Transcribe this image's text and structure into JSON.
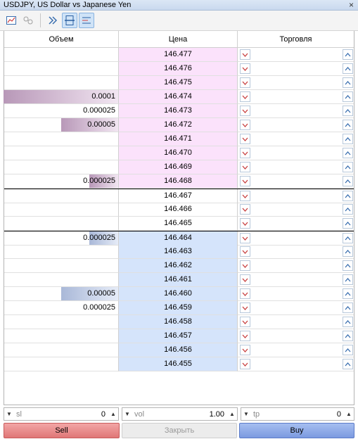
{
  "window": {
    "title": "USDJPY, US Dollar vs Japanese Yen",
    "close_glyph": "×"
  },
  "toolbar": {
    "icons": [
      "chart-icon",
      "linked-chart-icon",
      "auto-scroll-icon",
      "center-price-icon",
      "tick-chart-icon"
    ]
  },
  "table": {
    "headers": {
      "volume": "Объем",
      "price": "Цена",
      "trading": "Торговля"
    },
    "rows": [
      {
        "price": "146.477",
        "volume": "",
        "side": "ask",
        "bar_fraction": 0
      },
      {
        "price": "146.476",
        "volume": "",
        "side": "ask",
        "bar_fraction": 0
      },
      {
        "price": "146.475",
        "volume": "",
        "side": "ask",
        "bar_fraction": 0
      },
      {
        "price": "146.474",
        "volume": "0.0001",
        "side": "ask",
        "bar_fraction": 1.0
      },
      {
        "price": "146.473",
        "volume": "0.000025",
        "side": "ask",
        "bar_fraction": 0
      },
      {
        "price": "146.472",
        "volume": "0.00005",
        "side": "ask",
        "bar_fraction": 0.5
      },
      {
        "price": "146.471",
        "volume": "",
        "side": "ask",
        "bar_fraction": 0
      },
      {
        "price": "146.470",
        "volume": "",
        "side": "ask",
        "bar_fraction": 0
      },
      {
        "price": "146.469",
        "volume": "",
        "side": "ask",
        "bar_fraction": 0
      },
      {
        "price": "146.468",
        "volume": "0.000025",
        "side": "ask",
        "bar_fraction": 0.25
      },
      {
        "price": "146.467",
        "volume": "",
        "side": "spread",
        "bar_fraction": 0
      },
      {
        "price": "146.466",
        "volume": "",
        "side": "spread",
        "bar_fraction": 0
      },
      {
        "price": "146.465",
        "volume": "",
        "side": "spread",
        "bar_fraction": 0
      },
      {
        "price": "146.464",
        "volume": "0.000025",
        "side": "bid",
        "bar_fraction": 0.25
      },
      {
        "price": "146.463",
        "volume": "",
        "side": "bid",
        "bar_fraction": 0
      },
      {
        "price": "146.462",
        "volume": "",
        "side": "bid",
        "bar_fraction": 0
      },
      {
        "price": "146.461",
        "volume": "",
        "side": "bid",
        "bar_fraction": 0
      },
      {
        "price": "146.460",
        "volume": "0.00005",
        "side": "bid",
        "bar_fraction": 0.5
      },
      {
        "price": "146.459",
        "volume": "0.000025",
        "side": "bid",
        "bar_fraction": 0
      },
      {
        "price": "146.458",
        "volume": "",
        "side": "bid",
        "bar_fraction": 0
      },
      {
        "price": "146.457",
        "volume": "",
        "side": "bid",
        "bar_fraction": 0
      },
      {
        "price": "146.456",
        "volume": "",
        "side": "bid",
        "bar_fraction": 0
      },
      {
        "price": "146.455",
        "volume": "",
        "side": "bid",
        "bar_fraction": 0
      }
    ]
  },
  "fields": {
    "sl": {
      "label": "sl",
      "value": "0"
    },
    "vol": {
      "label": "vol",
      "value": "1.00"
    },
    "tp": {
      "label": "tp",
      "value": "0"
    }
  },
  "actions": {
    "sell": "Sell",
    "close": "Закрыть",
    "buy": "Buy"
  },
  "colors": {
    "ask_bg": "#fbe2fb",
    "bid_bg": "#d5e4fb",
    "ask_bar": "#b898b8",
    "bid_bar": "#a9b8d8",
    "sell_button": "#e07676",
    "buy_button": "#7b9ae0"
  }
}
